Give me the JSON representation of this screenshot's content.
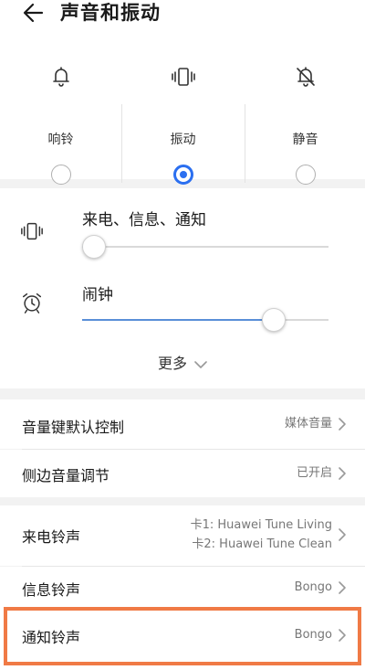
{
  "header": {
    "title": "声音和振动",
    "back_icon": "arrow-left-icon"
  },
  "modes": [
    {
      "label": "响铃",
      "icon": "bell-icon",
      "selected": false
    },
    {
      "label": "振动",
      "icon": "vibrate-icon",
      "selected": true
    },
    {
      "label": "静音",
      "icon": "bell-off-icon",
      "selected": false
    }
  ],
  "volumes": [
    {
      "label": "来电、信息、通知",
      "icon": "vibrate-icon",
      "level": 0
    },
    {
      "label": "闹钟",
      "icon": "alarm-clock-icon",
      "level": 80
    }
  ],
  "more": {
    "label": "更多"
  },
  "settings": [
    {
      "label": "音量键默认控制",
      "value": "媒体音量"
    },
    {
      "label": "侧边音量调节",
      "value": "已开启"
    },
    {
      "label": "来电铃声",
      "value_line1": "卡1: Huawei Tune Living",
      "value_line2": "卡2: Huawei Tune Clean"
    },
    {
      "label": "信息铃声",
      "value": "Bongo"
    },
    {
      "label": "通知铃声",
      "value": "Bongo"
    }
  ],
  "colors": {
    "accent": "#2b6ff0",
    "highlight": "#f07a45",
    "slider_fill": "#5a8fd8"
  }
}
